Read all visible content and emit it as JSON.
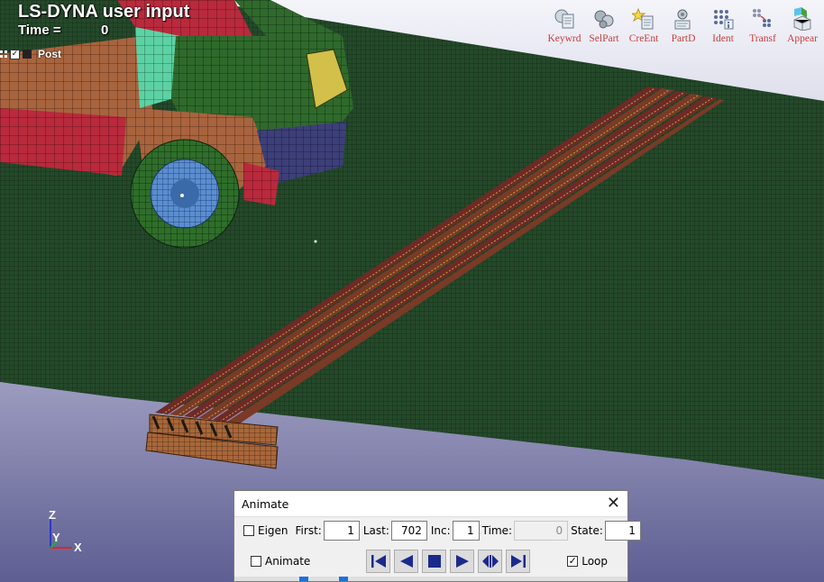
{
  "viewport": {
    "title": "LS-DYNA user input",
    "time_label": "Time =",
    "time_value": "0",
    "post_label": "Post"
  },
  "toolbar": {
    "tools": [
      {
        "label": "Keywrd",
        "icon": "keyword-icon"
      },
      {
        "label": "SelPart",
        "icon": "select-part-icon"
      },
      {
        "label": "CreEnt",
        "icon": "create-entity-icon"
      },
      {
        "label": "PartD",
        "icon": "part-data-icon"
      },
      {
        "label": "Ident",
        "icon": "identify-icon"
      },
      {
        "label": "Transf",
        "icon": "transform-icon"
      },
      {
        "label": "Appear",
        "icon": "appearance-icon"
      }
    ],
    "label_color": "#c83c3c"
  },
  "axis": {
    "x": "X",
    "y": "Y",
    "z": "Z"
  },
  "animate_dialog": {
    "title": "Animate",
    "eigen_label": "Eigen",
    "eigen_checked": false,
    "first_label": "First:",
    "first_value": "1",
    "last_label": "Last:",
    "last_value": "702",
    "inc_label": "Inc:",
    "inc_value": "1",
    "time_label": "Time:",
    "time_value": "0",
    "state_label": "State:",
    "state_value": "1",
    "animate_label": "Animate",
    "animate_checked": false,
    "loop_label": "Loop",
    "loop_checked": true,
    "controls": [
      "first-frame-icon",
      "reverse-play-icon",
      "stop-icon",
      "play-icon",
      "bounce-play-icon",
      "last-frame-icon"
    ]
  },
  "colors": {
    "ground": "#234a28",
    "road_stripe": "#6e2a26",
    "background_bottom": "#6a6a9c",
    "vehicle_green": "#2d6a2a",
    "vehicle_mint": "#63d6a8",
    "vehicle_red": "#b8283c"
  }
}
